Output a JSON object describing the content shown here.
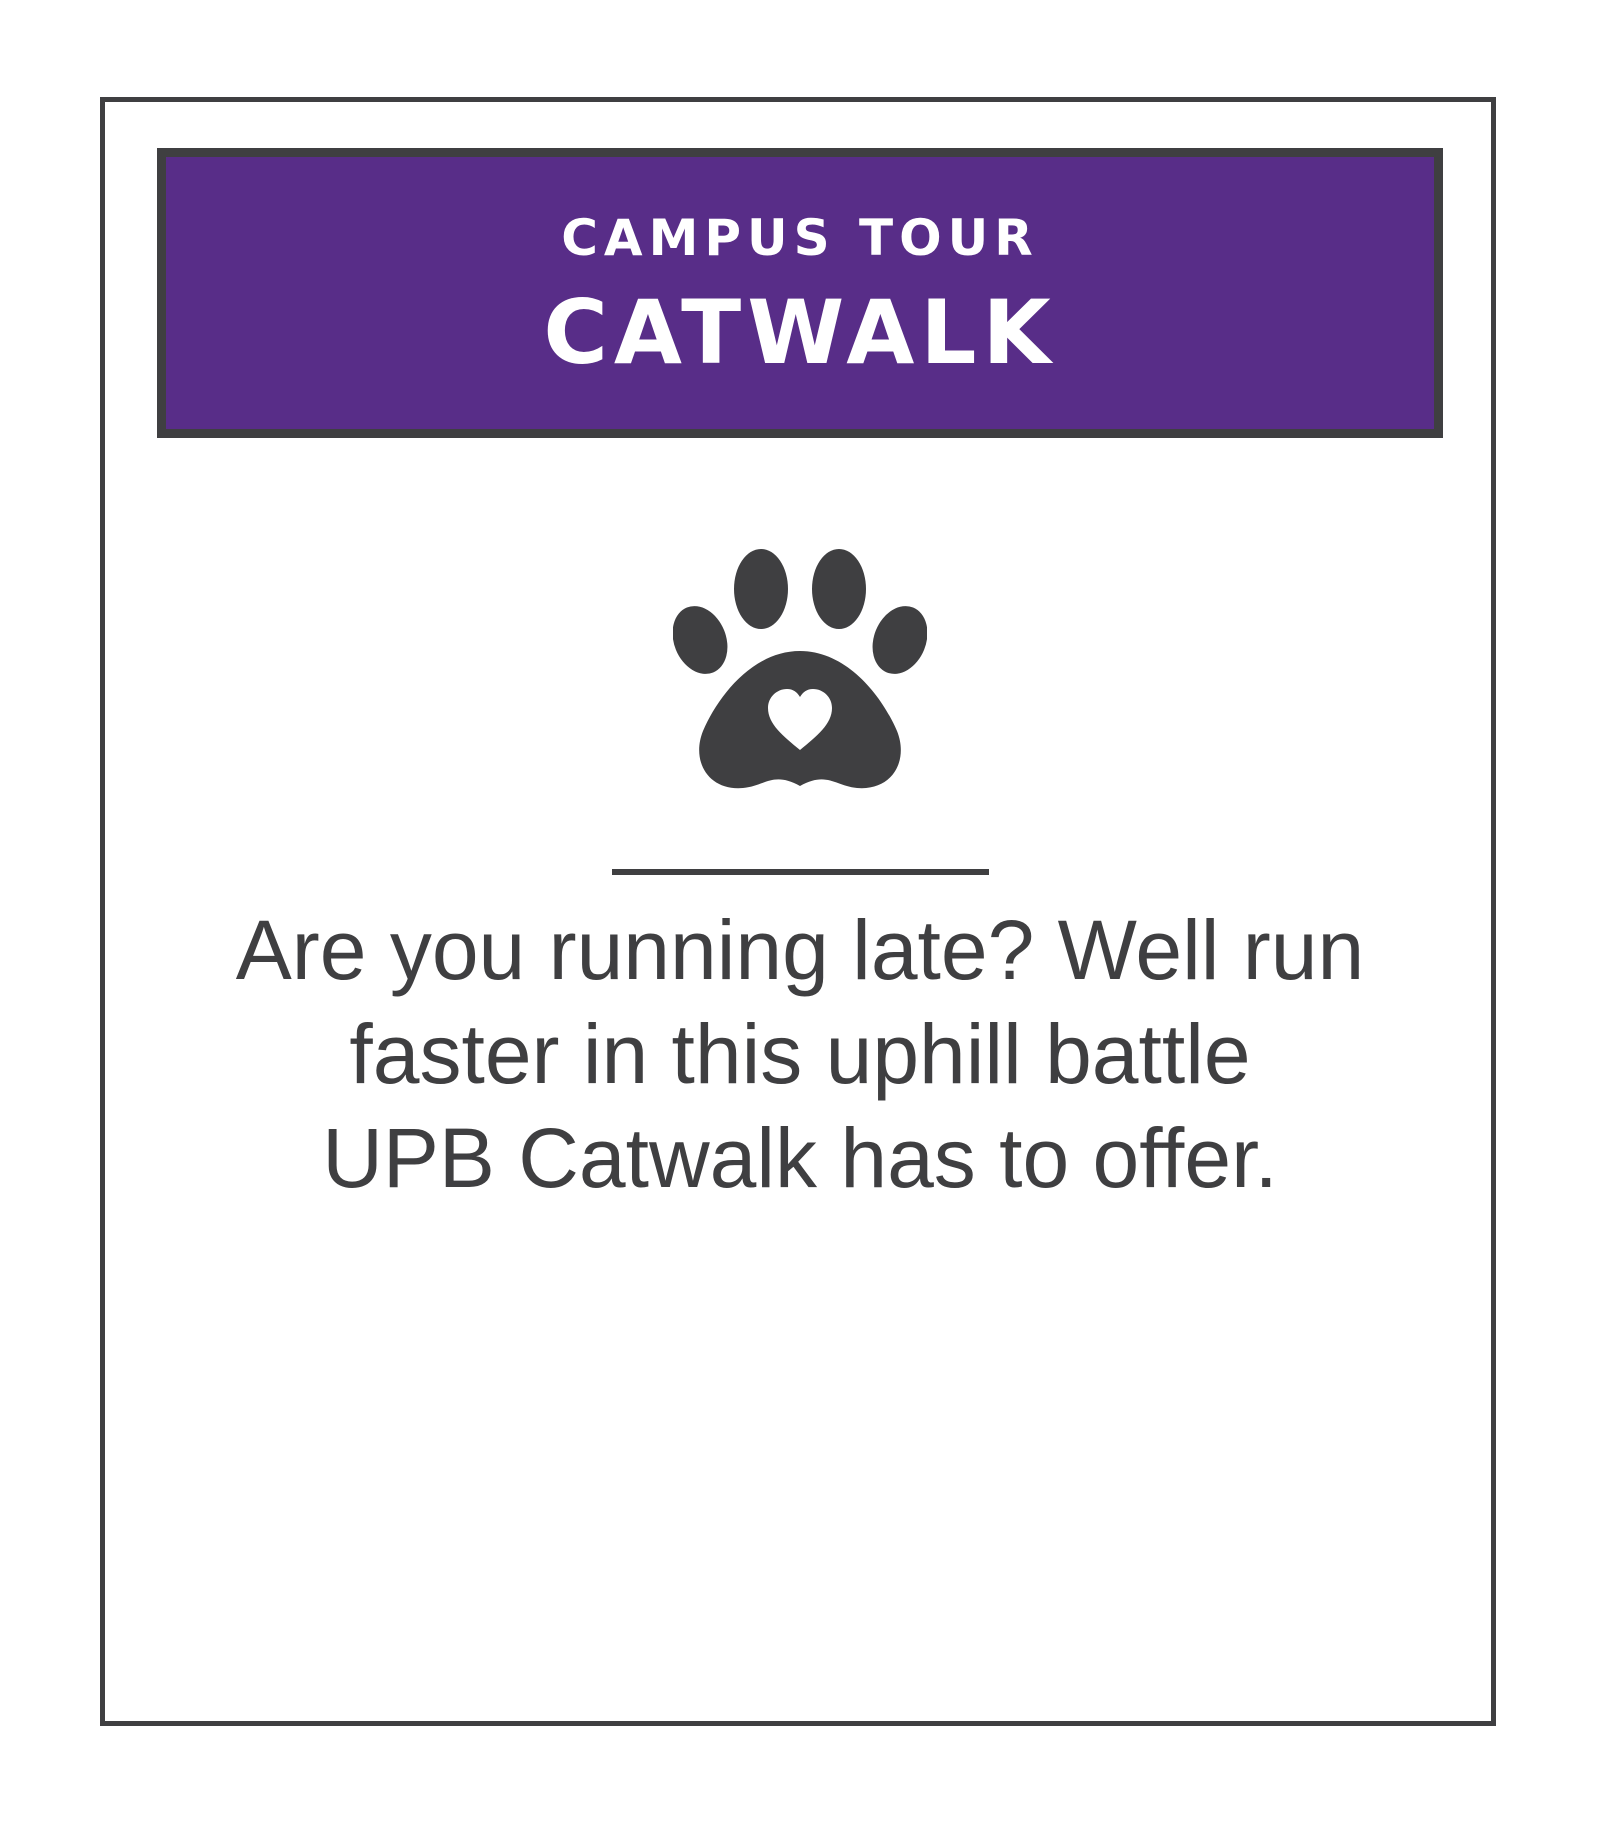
{
  "banner": {
    "subtitle": "CAMPUS TOUR",
    "title": "CATWALK"
  },
  "icon": {
    "name": "paw-heart-icon"
  },
  "description": {
    "lines": [
      "Are you running late? Well run",
      "faster in this uphill battle",
      "UPB Catwalk has to offer."
    ]
  },
  "colors": {
    "banner_background": "#582d88",
    "border": "#3f3f41",
    "text": "#3f3f41",
    "background": "#ffffff"
  }
}
